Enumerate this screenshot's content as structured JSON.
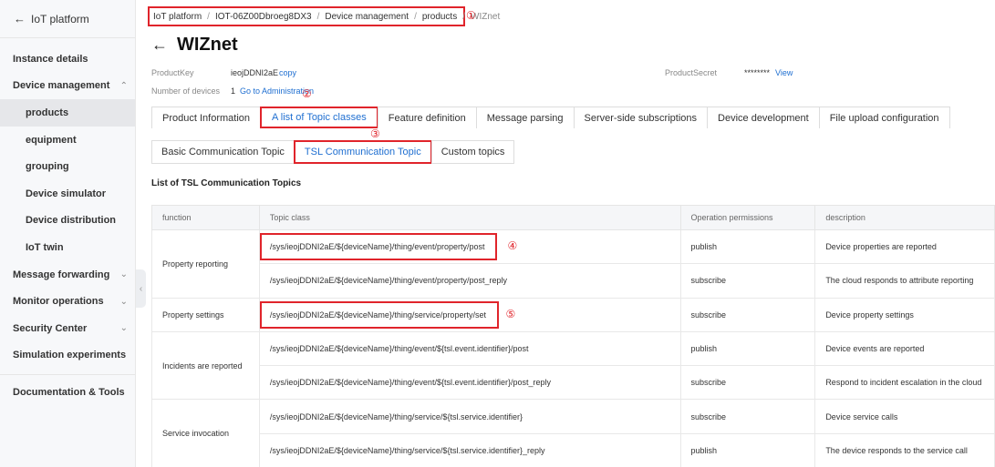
{
  "sidebar": {
    "header": "IoT platform",
    "items": [
      {
        "label": "Instance details"
      },
      {
        "label": "Device management"
      },
      {
        "label": "products"
      },
      {
        "label": "equipment"
      },
      {
        "label": "grouping"
      },
      {
        "label": "Device simulator"
      },
      {
        "label": "Device distribution"
      },
      {
        "label": "IoT twin"
      },
      {
        "label": "Message forwarding"
      },
      {
        "label": "Monitor operations"
      },
      {
        "label": "Security Center"
      },
      {
        "label": "Simulation experiments"
      },
      {
        "label": "Documentation & Tools"
      }
    ]
  },
  "breadcrumb": [
    "IoT platform",
    "IOT-06Z00Dbroeg8DX3",
    "Device management",
    "products",
    "WIZnet"
  ],
  "annotations": [
    "①",
    "②",
    "③",
    "④",
    "⑤"
  ],
  "page": {
    "title": "WIZnet",
    "product_key_label": "ProductKey",
    "product_key_value": "ieojDDNI2aE",
    "copy_label": "copy",
    "product_secret_label": "ProductSecret",
    "product_secret_value": "********",
    "view_label": "View",
    "devices_label": "Number of devices",
    "devices_value": "1",
    "go_admin_label": "Go to Administration"
  },
  "tabs": [
    "Product Information",
    "A list of Topic classes",
    "Feature definition",
    "Message parsing",
    "Server-side subscriptions",
    "Device development",
    "File upload configuration"
  ],
  "subtabs": [
    "Basic Communication Topic",
    "TSL Communication Topic",
    "Custom topics"
  ],
  "section_title": "List of TSL Communication Topics",
  "table": {
    "headers": [
      "function",
      "Topic class",
      "Operation permissions",
      "description"
    ],
    "groups": [
      {
        "function": "Property reporting",
        "rows": [
          {
            "topic": "/sys/ieojDDNI2aE/${deviceName}/thing/event/property/post",
            "perm": "publish",
            "desc": "Device properties are reported"
          },
          {
            "topic": "/sys/ieojDDNI2aE/${deviceName}/thing/event/property/post_reply",
            "perm": "subscribe",
            "desc": "The cloud responds to attribute reporting"
          }
        ]
      },
      {
        "function": "Property settings",
        "rows": [
          {
            "topic": "/sys/ieojDDNI2aE/${deviceName}/thing/service/property/set",
            "perm": "subscribe",
            "desc": "Device property settings"
          }
        ]
      },
      {
        "function": "Incidents are reported",
        "rows": [
          {
            "topic": "/sys/ieojDDNI2aE/${deviceName}/thing/event/${tsl.event.identifier}/post",
            "perm": "publish",
            "desc": "Device events are reported"
          },
          {
            "topic": "/sys/ieojDDNI2aE/${deviceName}/thing/event/${tsl.event.identifier}/post_reply",
            "perm": "subscribe",
            "desc": "Respond to incident escalation in the cloud"
          }
        ]
      },
      {
        "function": "Service invocation",
        "rows": [
          {
            "topic": "/sys/ieojDDNI2aE/${deviceName}/thing/service/${tsl.service.identifier}",
            "perm": "subscribe",
            "desc": "Device service calls"
          },
          {
            "topic": "/sys/ieojDDNI2aE/${deviceName}/thing/service/${tsl.service.identifier}_reply",
            "perm": "publish",
            "desc": "The device responds to the service call"
          }
        ]
      }
    ]
  },
  "colors": {
    "accent": "#1f6fd1",
    "highlight": "#e0242b"
  }
}
